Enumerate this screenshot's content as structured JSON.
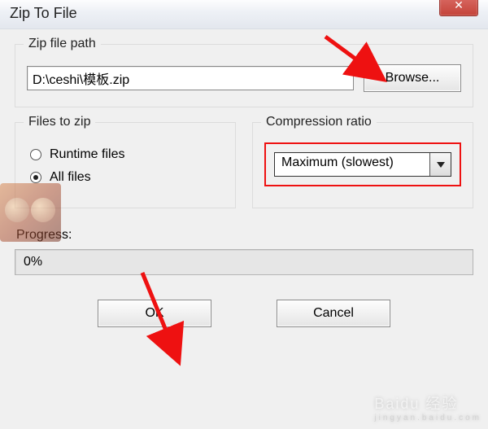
{
  "window": {
    "title": "Zip To File",
    "close_glyph": "✕"
  },
  "zip_path": {
    "legend": "Zip file path",
    "value": "D:\\ceshi\\模板.zip",
    "browse_label": "Browse..."
  },
  "files_to_zip": {
    "legend": "Files to zip",
    "options": [
      {
        "label": "Runtime files",
        "checked": false
      },
      {
        "label": "All files",
        "checked": true
      }
    ]
  },
  "compression": {
    "legend": "Compression ratio",
    "selected": "Maximum (slowest)"
  },
  "progress": {
    "label": "Progress:",
    "text": "0%"
  },
  "actions": {
    "ok": "OK",
    "cancel": "Cancel"
  },
  "watermark": {
    "brand": "Baidu 经验",
    "url": "jingyan.baidu.com"
  }
}
